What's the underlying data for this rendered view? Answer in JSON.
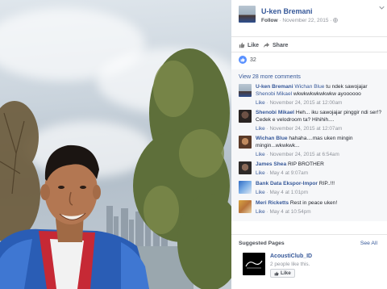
{
  "post": {
    "author": "U-ken Bremani",
    "follow_label": "Follow",
    "separator": "·",
    "date": "November 22, 2015",
    "privacy_icon": "globe-icon",
    "menu_icon": "chevron-down-icon"
  },
  "actions": {
    "like_label": "Like",
    "share_label": "Share"
  },
  "reactions": {
    "count": "32",
    "icon": "thumbs-up-icon"
  },
  "comments_section": {
    "view_more_label": "View 28 more comments"
  },
  "comments": [
    {
      "name": "U-ken Bremani",
      "tag1": "Wichan Blue",
      "text1": " tu ndek sawojajar ",
      "tag2": "Shenobi Mikael",
      "text2": " wkwkwkwkwkwkw ayoooooo",
      "like": "Like",
      "time": "November 24, 2015 at 12:00am"
    },
    {
      "name": "Shenobi Mikael",
      "text": "Heh... iku sawojajar pinggir ndi ser!? Cedek e velodroom ta? Hihihih....",
      "like": "Like",
      "time": "November 24, 2015 at 12:07am"
    },
    {
      "name": "Wichan Blue",
      "text": "hahaha....mas uken mingin mingin...wkwkwk...",
      "like": "Like",
      "time": "November 24, 2015 at 6:54am"
    },
    {
      "name": "James Shea",
      "text": "RIP BROTHER",
      "like": "Like",
      "time": "May 4 at 9:07am"
    },
    {
      "name": "Bank Data Ekspor-Impor",
      "text": "RIP..!!!",
      "like": "Like",
      "time": "May 4 at 1:01pm"
    },
    {
      "name": "Meri Ricketts",
      "text": "Rest in peace uken!",
      "like": "Like",
      "time": "May 4 at 10:54pm"
    }
  ],
  "separator": "·",
  "suggested": {
    "title": "Suggested Pages",
    "see_all": "See All",
    "page_name": "AcoustiClub_ID",
    "page_sub": "2 people like this.",
    "like_label": "Like"
  },
  "colors": {
    "link": "#365899",
    "meta": "#90949c",
    "like_blue": "#5890ff"
  }
}
